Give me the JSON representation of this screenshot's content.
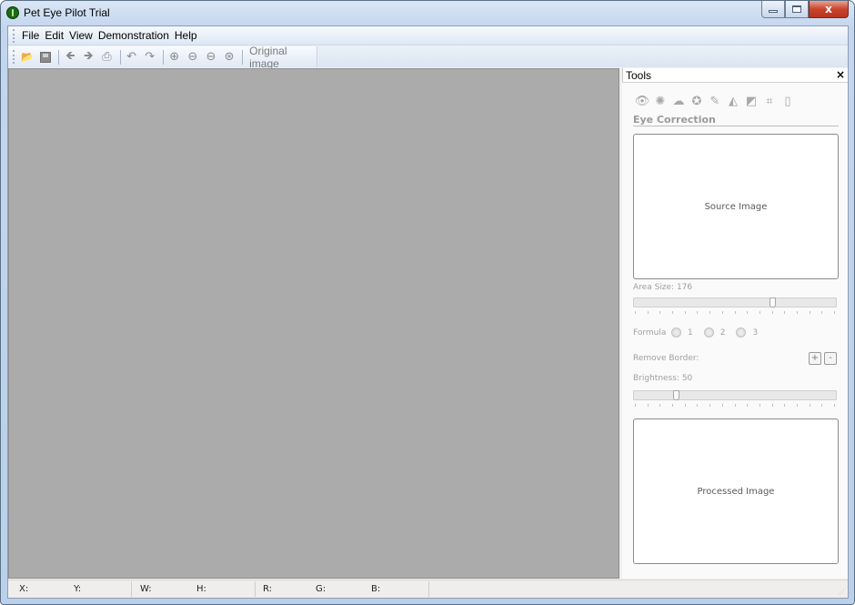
{
  "window": {
    "title": "Pet Eye Pilot Trial",
    "close_glyph": "x"
  },
  "menubar": {
    "items": [
      "File",
      "Edit",
      "View",
      "Demonstration",
      "Help"
    ]
  },
  "toolbar": {
    "buttons": [
      {
        "name": "open-icon",
        "glyph": "📂"
      },
      {
        "name": "save-icon",
        "glyph": "💾"
      },
      {
        "name": "back-icon",
        "glyph": "◆"
      },
      {
        "name": "forward-icon",
        "glyph": "➔"
      },
      {
        "name": "print-icon",
        "glyph": "⎙"
      },
      {
        "name": "undo-icon",
        "glyph": "↶"
      },
      {
        "name": "redo-icon",
        "glyph": "↷"
      },
      {
        "name": "zoom-in-icon",
        "glyph": "⊕"
      },
      {
        "name": "zoom-out-icon",
        "glyph": "⊖"
      },
      {
        "name": "zoom-fit-icon",
        "glyph": "⊖"
      },
      {
        "name": "zoom-actual-icon",
        "glyph": "⊛"
      }
    ],
    "original_image_label": "Original image"
  },
  "tools_panel": {
    "title": "Tools",
    "close_glyph": "×",
    "tool_icons": [
      {
        "name": "eye-icon",
        "glyph": "👁"
      },
      {
        "name": "bulb-icon",
        "glyph": "✺"
      },
      {
        "name": "cloud-icon",
        "glyph": "☁"
      },
      {
        "name": "color-wheel-icon",
        "glyph": "✪"
      },
      {
        "name": "brush-icon",
        "glyph": "✎"
      },
      {
        "name": "levels-icon",
        "glyph": "◭"
      },
      {
        "name": "contrast-icon",
        "glyph": "◩"
      },
      {
        "name": "crop-icon",
        "glyph": "⌗"
      },
      {
        "name": "page-icon",
        "glyph": "▯"
      }
    ],
    "section_title": "Eye Correction",
    "source_image_label": "Source Image",
    "area_size_label": "Area Size: 176",
    "area_size_value": 176,
    "area_size_fraction": 0.69,
    "formula_label": "Formula",
    "formula_options": [
      "1",
      "2",
      "3"
    ],
    "remove_border_label": "Remove Border:",
    "plus_label": "+",
    "minus_label": "-",
    "brightness_label": "Brightness: 50",
    "brightness_value": 50,
    "brightness_fraction": 0.2,
    "processed_image_label": "Processed Image"
  },
  "statusbar": {
    "x_label": "X:",
    "y_label": "Y:",
    "w_label": "W:",
    "h_label": "H:",
    "r_label": "R:",
    "g_label": "G:",
    "b_label": "B:"
  }
}
